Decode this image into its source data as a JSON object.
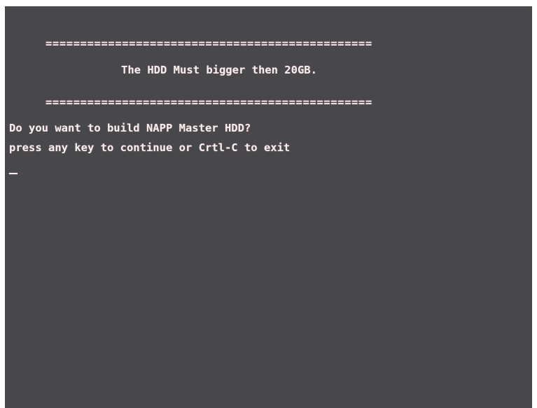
{
  "console": {
    "rule_top": "===============================================",
    "title": "The HDD Must bigger then 20GB.",
    "rule_bottom": "===============================================",
    "question": "Do you want to build NAPP Master HDD?",
    "instruction": "press any key to continue or Crtl-C to exit"
  },
  "colors": {
    "background": "#48474a",
    "text": "#f2eeee"
  }
}
